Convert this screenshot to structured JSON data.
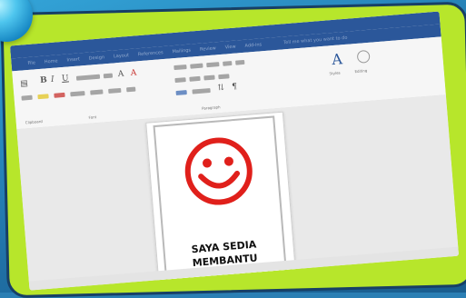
{
  "window": {
    "title": ""
  },
  "menu": {
    "items": [
      "File",
      "Home",
      "Insert",
      "Design",
      "Layout",
      "References",
      "Mailings",
      "Review",
      "View",
      "Add-ins"
    ],
    "tell_me": "Tell me what you want to do"
  },
  "ribbon": {
    "groups": [
      "Clipboard",
      "Font",
      "Paragraph",
      "Styles",
      "Editing"
    ],
    "styles_label": "Styles",
    "editing_label": "Editing"
  },
  "document": {
    "card_text_line1": "SAYA SEDIA",
    "card_text_line2": "MEMBANTU",
    "smiley_color": "#e0201b"
  },
  "colors": {
    "frame": "#b7e62b",
    "frame_border": "#173f66",
    "accent": "#2b579a"
  }
}
